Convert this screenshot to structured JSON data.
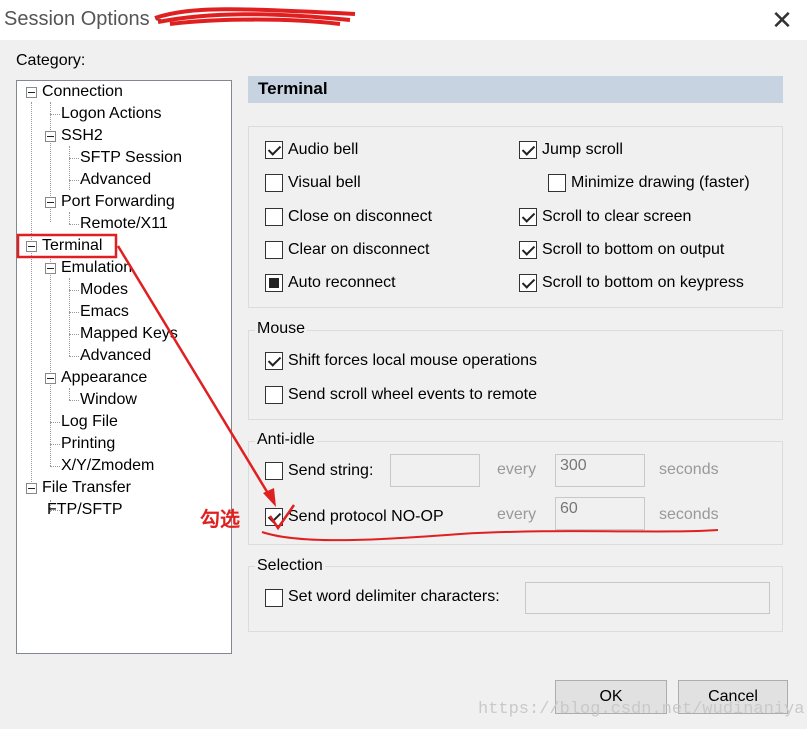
{
  "window": {
    "title": "Session Options -"
  },
  "category_label": "Category:",
  "tree": {
    "connection": "Connection",
    "logon_actions": "Logon Actions",
    "ssh2": "SSH2",
    "sftp_session": "SFTP Session",
    "advanced_ssh": "Advanced",
    "port_forwarding": "Port Forwarding",
    "remote_x11": "Remote/X11",
    "terminal": "Terminal",
    "emulation": "Emulation",
    "modes": "Modes",
    "emacs": "Emacs",
    "mapped_keys": "Mapped Keys",
    "advanced_emul": "Advanced",
    "appearance": "Appearance",
    "window": "Window",
    "log_file": "Log File",
    "printing": "Printing",
    "xyzmodem": "X/Y/Zmodem",
    "file_transfer": "File Transfer",
    "ftp_sftp": "FTP/SFTP"
  },
  "panel_title": "Terminal",
  "terminal": {
    "audio_bell": {
      "label": "Audio bell",
      "checked": true
    },
    "visual_bell": {
      "label": "Visual bell",
      "checked": false
    },
    "close_on_disconnect": {
      "label": "Close on disconnect",
      "checked": false
    },
    "clear_on_disconnect": {
      "label": "Clear on disconnect",
      "checked": false
    },
    "auto_reconnect": {
      "label": "Auto reconnect",
      "state": "indeterminate"
    },
    "jump_scroll": {
      "label": "Jump scroll",
      "checked": true
    },
    "minimize_drawing": {
      "label": "Minimize drawing (faster)",
      "checked": false
    },
    "scroll_to_clear": {
      "label": "Scroll to clear screen",
      "checked": true
    },
    "scroll_bottom_output": {
      "label": "Scroll to bottom on output",
      "checked": true
    },
    "scroll_bottom_keypress": {
      "label": "Scroll to bottom on keypress",
      "checked": true
    }
  },
  "mouse": {
    "title": "Mouse",
    "shift_forces": {
      "label": "Shift forces local mouse operations",
      "checked": true
    },
    "send_scroll": {
      "label": "Send scroll wheel events to remote",
      "checked": false
    }
  },
  "anti_idle": {
    "title": "Anti-idle",
    "send_string": {
      "label": "Send string:",
      "checked": false,
      "value": ""
    },
    "every_label": "every",
    "string_interval": "300",
    "seconds_label": "seconds",
    "send_noop": {
      "label": "Send protocol NO-OP",
      "checked": true
    },
    "noop_interval": "60"
  },
  "selection": {
    "title": "Selection",
    "word_delimiter": {
      "label": "Set word delimiter characters:",
      "checked": false,
      "value": ""
    }
  },
  "buttons": {
    "ok": "OK",
    "cancel": "Cancel"
  },
  "annotation": {
    "text": "勾选",
    "color": "#e02020"
  },
  "watermark": "https://blog.csdn.net/wudinaniya"
}
